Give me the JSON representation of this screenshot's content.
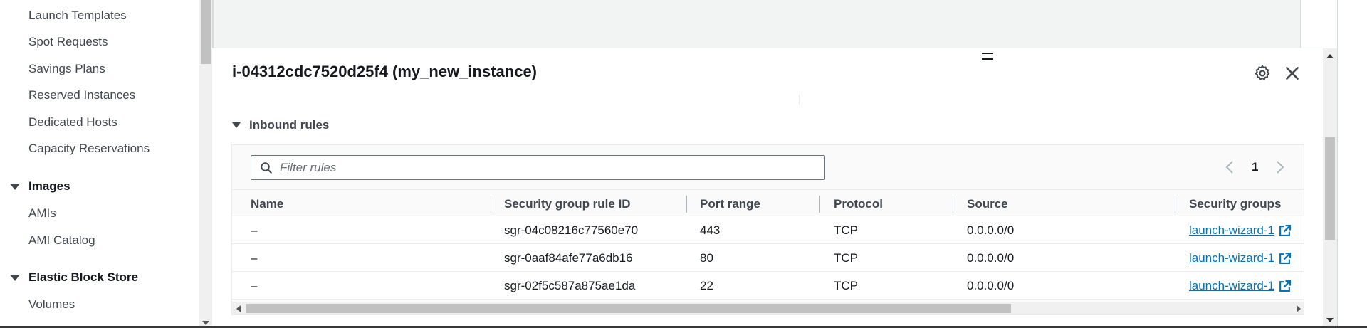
{
  "sidebar": {
    "items": [
      {
        "label": "Launch Templates"
      },
      {
        "label": "Spot Requests"
      },
      {
        "label": "Savings Plans"
      },
      {
        "label": "Reserved Instances"
      },
      {
        "label": "Dedicated Hosts"
      },
      {
        "label": "Capacity Reservations"
      }
    ],
    "images_section": {
      "label": "Images",
      "items": [
        {
          "label": "AMIs"
        },
        {
          "label": "AMI Catalog"
        }
      ]
    },
    "ebs_section": {
      "label": "Elastic Block Store",
      "items": [
        {
          "label": "Volumes"
        }
      ]
    }
  },
  "panel": {
    "title": "i-04312cdc7520d25f4 (my_new_instance)",
    "section_label": "Inbound rules",
    "filter_placeholder": "Filter rules",
    "page_number": "1",
    "columns": [
      "Name",
      "Security group rule ID",
      "Port range",
      "Protocol",
      "Source",
      "Security groups"
    ],
    "rows": [
      {
        "name": "–",
        "rule_id": "sgr-04c08216c77560e70",
        "port_range": "443",
        "protocol": "TCP",
        "source": "0.0.0.0/0",
        "security_group": "launch-wizard-1"
      },
      {
        "name": "–",
        "rule_id": "sgr-0aaf84afe77a6db16",
        "port_range": "80",
        "protocol": "TCP",
        "source": "0.0.0.0/0",
        "security_group": "launch-wizard-1"
      },
      {
        "name": "–",
        "rule_id": "sgr-02f5c587a875ae1da",
        "port_range": "22",
        "protocol": "TCP",
        "source": "0.0.0.0/0",
        "security_group": "launch-wizard-1"
      }
    ]
  },
  "icons": {
    "settings": "gear-icon",
    "close": "close-icon",
    "search": "search-icon",
    "external_link": "external-link-icon"
  },
  "colors": {
    "link": "#0073bb",
    "text": "#16191f",
    "muted": "#414750"
  }
}
